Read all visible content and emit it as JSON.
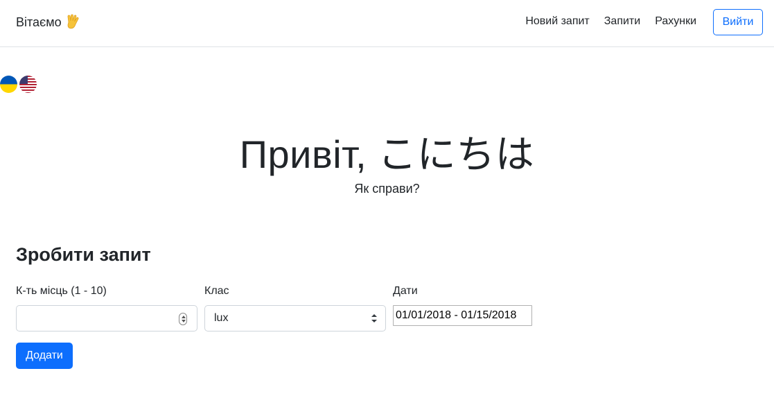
{
  "brand": {
    "text": "Вітаємо",
    "icon": "vulcan-salute-hand-icon"
  },
  "nav": {
    "links": [
      "Новий запит",
      "Запити",
      "Рахунки"
    ],
    "logout_label": "Вийти"
  },
  "flags": [
    "ukraine-flag-icon",
    "usa-flag-icon"
  ],
  "hero": {
    "title": "Привіт, こにちは",
    "subtitle": "Як справи?"
  },
  "form": {
    "title": "Зробити запит",
    "seats_label": "К-ть місць (1 - 10)",
    "seats_value": "",
    "class_label": "Клас",
    "class_value": "lux",
    "dates_label": "Дати",
    "dates_value": "01/01/2018 - 01/15/2018",
    "submit_label": "Додати"
  },
  "colors": {
    "accent": "#0d6efd",
    "text": "#212529",
    "border": "#ced4da"
  }
}
